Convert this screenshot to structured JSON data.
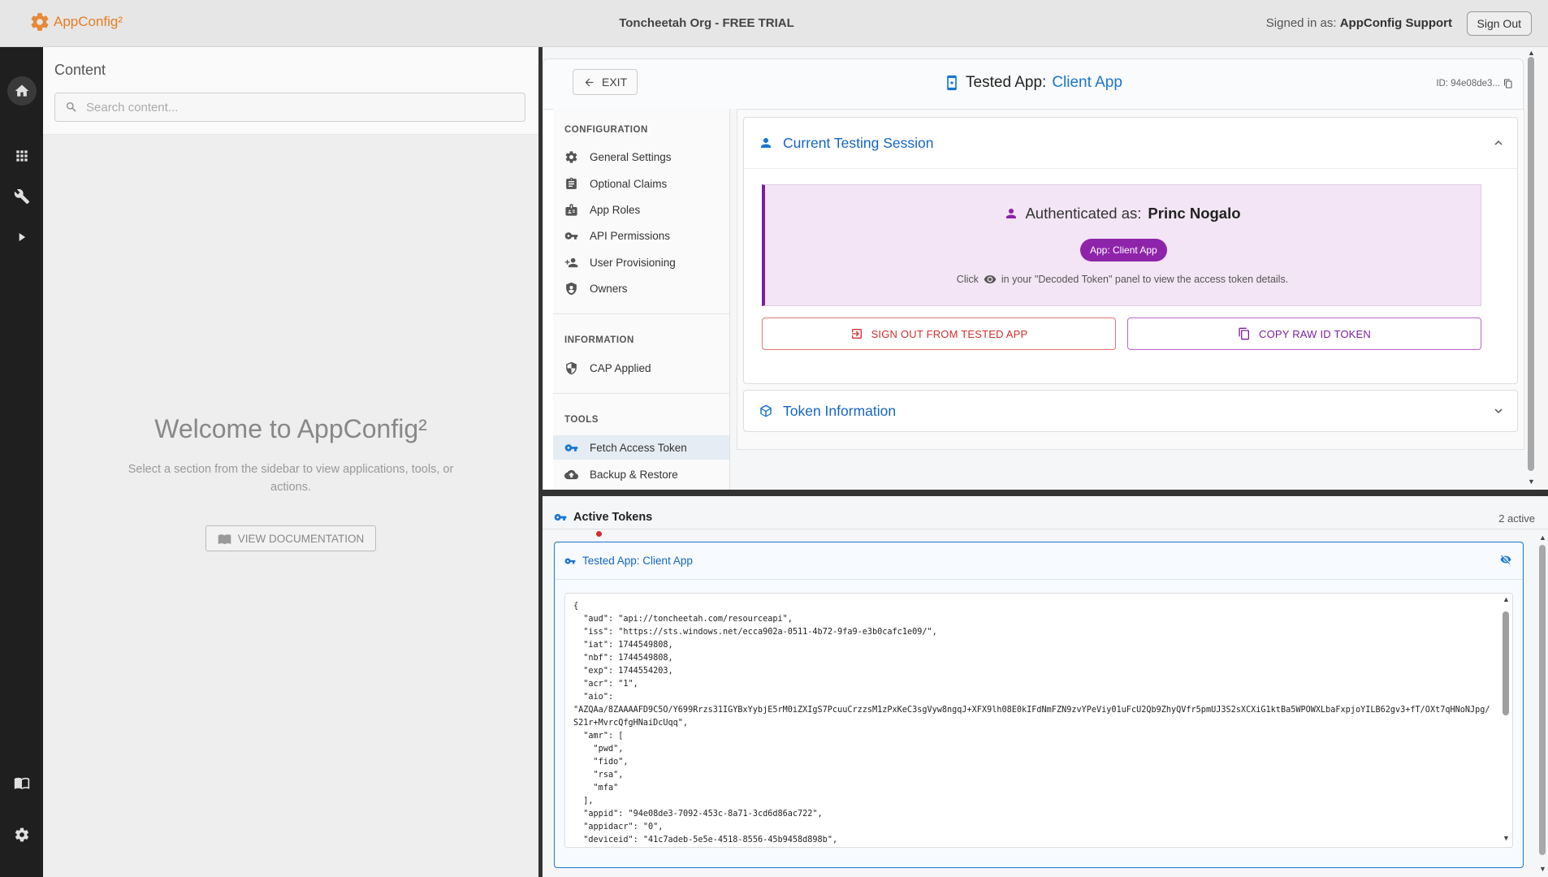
{
  "header": {
    "logo_text": "AppConfig²",
    "org_title": "Toncheetah Org - FREE TRIAL",
    "signed_in_prefix": "Signed in as:",
    "signed_in_user": "AppConfig Support",
    "sign_out_label": "Sign Out"
  },
  "rail": {
    "items": [
      "home-icon",
      "apps-grid-icon",
      "wrench-icon",
      "play-icon",
      "book-icon",
      "gear-icon"
    ]
  },
  "content_panel": {
    "title": "Content",
    "search_placeholder": "Search content...",
    "welcome_title": "Welcome to AppConfig²",
    "welcome_text": "Select a section from the sidebar to view applications, tools, or actions.",
    "doc_button_label": "VIEW DOCUMENTATION"
  },
  "app_header": {
    "exit_label": "EXIT",
    "title_prefix": "Tested App:",
    "app_name": "Client App",
    "id_label": "ID: 94e08de3..."
  },
  "config_sidebar": {
    "sections": [
      {
        "title": "CONFIGURATION",
        "items": [
          {
            "label": "General Settings",
            "icon": "gear-icon"
          },
          {
            "label": "Optional Claims",
            "icon": "clipboard-icon"
          },
          {
            "label": "App Roles",
            "icon": "badge-icon"
          },
          {
            "label": "API Permissions",
            "icon": "key-icon"
          },
          {
            "label": "User Provisioning",
            "icon": "person-add-icon"
          },
          {
            "label": "Owners",
            "icon": "owners-icon"
          }
        ]
      },
      {
        "title": "INFORMATION",
        "items": [
          {
            "label": "CAP Applied",
            "icon": "shield-icon"
          }
        ]
      },
      {
        "title": "TOOLS",
        "items": [
          {
            "label": "Fetch Access Token",
            "icon": "key-icon",
            "active": true
          },
          {
            "label": "Backup & Restore",
            "icon": "cloud-icon"
          }
        ]
      }
    ]
  },
  "session": {
    "title": "Current Testing Session",
    "auth_prefix": "Authenticated as:",
    "auth_user": "Princ Nogalo",
    "app_chip": "App: Client App",
    "hint_prefix": "Click",
    "hint_suffix": "in your \"Decoded Token\" panel to view the access token details.",
    "sign_out_label": "SIGN OUT FROM TESTED APP",
    "copy_label": "COPY RAW ID TOKEN"
  },
  "token_info": {
    "title": "Token Information"
  },
  "active_tokens": {
    "title": "Active Tokens",
    "count_label": "2 active",
    "card_title": "Tested App: Client App",
    "json_text": "{\n  \"aud\": \"api://toncheetah.com/resourceapi\",\n  \"iss\": \"https://sts.windows.net/ecca902a-0511-4b72-9fa9-e3b0cafc1e09/\",\n  \"iat\": 1744549808,\n  \"nbf\": 1744549808,\n  \"exp\": 1744554203,\n  \"acr\": \"1\",\n  \"aio\":\n\"AZQAa/8ZAAAAFD9C5O/Y699Rrzs31IGYBxYybjE5rM0iZXIgS7PcuuCrzzsM1zPxKeC3sgVyw8ngqJ+XFX9lh08E0kIFdNmFZN9zvYPeViy01uFcU2Qb9ZhyQVfr5pmUJ3S2sXCXiG1ktBa5WPOWXLbaFxpjoYILB62gv3+fT/OXt7qHNoNJpg/S21r+MvrcQfgHNaiDcUqq\",\n  \"amr\": [\n    \"pwd\",\n    \"fido\",\n    \"rsa\",\n    \"mfa\"\n  ],\n  \"appid\": \"94e08de3-7092-453c-8a71-3cd6d86ac722\",\n  \"appidacr\": \"0\",\n  \"deviceid\": \"41c7adeb-5e5e-4518-8556-45b9458d898b\","
  }
}
